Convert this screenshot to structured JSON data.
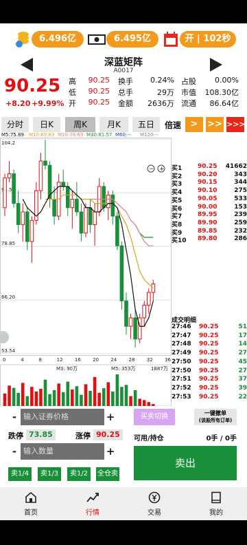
{
  "stats_bar": {
    "total_amount_1": "6.496亿",
    "total_amount_2": "6.495亿",
    "market_status": "开 | 102秒"
  },
  "stock": {
    "name": "深蓝矩阵",
    "code": "A0017",
    "price": "90.25",
    "change": "+8.20",
    "change_pct": "+9.99%"
  },
  "quote": {
    "high_label": "高",
    "high": "90.25",
    "low_label": "低",
    "low": "90.25",
    "open_label": "开",
    "open": "90.25",
    "turnover_label": "换手",
    "turnover": "0.24%",
    "total_shares_label": "总手",
    "total_shares": "29万",
    "amount_label": "金额",
    "amount": "2636万",
    "share_label": "占股",
    "share": "0.00%",
    "mktcap_label": "市值",
    "mktcap": "108.30亿",
    "float_label": "流通",
    "float": "86.64亿"
  },
  "tabs": [
    {
      "label": "分时"
    },
    {
      "label": "日K"
    },
    {
      "label": "周K"
    },
    {
      "label": "月K"
    },
    {
      "label": "五日"
    }
  ],
  "speed_label": "倍速",
  "speed_buttons": [
    ">",
    ">>",
    ">>>"
  ],
  "ma_legend": [
    {
      "label": "M5:75.89",
      "color": "#111111"
    },
    {
      "label": "M10:69.83",
      "color": "#e0a020"
    },
    {
      "label": "M20:78.69",
      "color": "#e08080"
    },
    {
      "label": "M30:81.57",
      "color": "#1a8f3a"
    },
    {
      "label": "M60:--",
      "color": "#2040d0"
    },
    {
      "label": "M120:--",
      "color": "#888888"
    }
  ],
  "y_ticks": [
    "104.2",
    "91.50",
    "78.85",
    "66.20",
    "53.54"
  ],
  "x_ticks": [
    "0",
    "4",
    "8",
    "12",
    "16",
    "20",
    "24",
    "28",
    "32",
    "36"
  ],
  "volume_legend": {
    "m3": "M3: 90万",
    "m5": "M5: 353万",
    "max": "1887万"
  },
  "order_book": [
    {
      "label": "买1",
      "price": "90.25",
      "vol": "41662"
    },
    {
      "label": "买2",
      "price": "90.20",
      "vol": "343"
    },
    {
      "label": "买3",
      "price": "90.15",
      "vol": "344"
    },
    {
      "label": "买4",
      "price": "90.10",
      "vol": "275"
    },
    {
      "label": "买5",
      "price": "90.05",
      "vol": "533"
    },
    {
      "label": "买6",
      "price": "90.00",
      "vol": "153"
    },
    {
      "label": "买7",
      "price": "89.95",
      "vol": "239"
    },
    {
      "label": "买8",
      "price": "89.90",
      "vol": "259"
    },
    {
      "label": "买9",
      "price": "89.85",
      "vol": "232"
    },
    {
      "label": "买10",
      "price": "89.80",
      "vol": "286"
    }
  ],
  "trades_title": "成交明细",
  "trades": [
    {
      "time": "27:46",
      "price": "90.25",
      "vol": "51"
    },
    {
      "time": "27:47",
      "price": "90.25",
      "vol": "17"
    },
    {
      "time": "27:48",
      "price": "90.25",
      "vol": "14"
    },
    {
      "time": "27:49",
      "price": "90.25",
      "vol": "27"
    },
    {
      "time": "27:50",
      "price": "90.25",
      "vol": "45"
    },
    {
      "time": "27:50",
      "price": "90.25",
      "vol": "27"
    },
    {
      "time": "27:51",
      "price": "90.25",
      "vol": "37"
    },
    {
      "time": "27:52",
      "price": "90.25",
      "vol": "39"
    },
    {
      "time": "27:53",
      "price": "90.25",
      "vol": "22"
    }
  ],
  "form": {
    "price_placeholder": "输入证券价格",
    "qty_placeholder": "输入数量",
    "limit_down_label": "跌停",
    "limit_down": "73.85",
    "limit_up_label": "涨停",
    "limit_up": "90.25",
    "switch_label": "买卖切换",
    "cancel_all_line1": "一键撤单",
    "cancel_all_line2": "(该股所有订单)",
    "avail_label": "可用/持仓",
    "avail_value": "0手 / 0手",
    "sell_label": "卖出",
    "quick": [
      "卖1/4",
      "卖1/3",
      "卖1/2",
      "全仓卖"
    ]
  },
  "nav": [
    {
      "label": "首页",
      "icon": "home-icon",
      "active": false
    },
    {
      "label": "行情",
      "icon": "chart-line-icon",
      "active": true
    },
    {
      "label": "交易",
      "icon": "yuan-exchange-icon",
      "active": false
    },
    {
      "label": "我的",
      "icon": "book-icon",
      "active": false
    }
  ],
  "chart_data": {
    "type": "candlestick",
    "x": [
      0,
      1,
      2,
      3,
      4,
      5,
      6,
      7,
      8,
      9,
      10,
      11,
      12,
      13,
      14,
      15,
      16,
      17,
      18,
      19,
      20,
      21,
      22,
      23,
      24,
      25,
      26,
      27,
      28,
      29,
      30,
      31,
      32,
      33
    ],
    "ohlc": [
      [
        88,
        96,
        86,
        95
      ],
      [
        95,
        99,
        94,
        96
      ],
      [
        96,
        97,
        88,
        89
      ],
      [
        89,
        92,
        82,
        84
      ],
      [
        84,
        89,
        80,
        87
      ],
      [
        87,
        88,
        78,
        80
      ],
      [
        80,
        86,
        75,
        85
      ],
      [
        85,
        94,
        84,
        92
      ],
      [
        92,
        101,
        90,
        99
      ],
      [
        99,
        104,
        97,
        98
      ],
      [
        98,
        99,
        88,
        90
      ],
      [
        90,
        93,
        84,
        86
      ],
      [
        86,
        96,
        85,
        94
      ],
      [
        94,
        97,
        92,
        93
      ],
      [
        93,
        94,
        86,
        88
      ],
      [
        88,
        92,
        83,
        90
      ],
      [
        90,
        94,
        86,
        87
      ],
      [
        87,
        89,
        80,
        82
      ],
      [
        82,
        89,
        81,
        88
      ],
      [
        88,
        90,
        82,
        84
      ],
      [
        84,
        89,
        79,
        87
      ],
      [
        87,
        95,
        86,
        93
      ],
      [
        93,
        94,
        87,
        88
      ],
      [
        88,
        92,
        85,
        91
      ],
      [
        91,
        92,
        84,
        86
      ],
      [
        86,
        87,
        78,
        79
      ],
      [
        79,
        80,
        64,
        66
      ],
      [
        66,
        68,
        58,
        60
      ],
      [
        60,
        63,
        57,
        62
      ],
      [
        62,
        64,
        55,
        57
      ],
      [
        57,
        63,
        56,
        62
      ],
      [
        62,
        66,
        60,
        65
      ],
      [
        65,
        69,
        63,
        68
      ],
      [
        68,
        71,
        66,
        70
      ]
    ],
    "ma5": [
      null,
      null,
      null,
      null,
      90,
      88,
      87,
      86,
      87,
      89,
      91,
      92,
      93,
      93,
      93,
      92,
      91,
      90,
      88,
      88,
      87,
      87,
      88,
      89,
      89,
      88,
      84,
      78,
      72,
      64,
      60,
      60,
      62,
      66
    ],
    "ma10": [
      null,
      null,
      null,
      null,
      null,
      null,
      null,
      null,
      null,
      90,
      90,
      90,
      90,
      91,
      91,
      91,
      91,
      90,
      90,
      90,
      89,
      89,
      89,
      89,
      89,
      88,
      86,
      84,
      81,
      77,
      73,
      71,
      70,
      69
    ],
    "ma20": [
      null,
      null,
      null,
      null,
      null,
      null,
      null,
      null,
      null,
      null,
      null,
      null,
      null,
      null,
      null,
      null,
      null,
      null,
      null,
      90,
      90,
      90,
      90,
      90,
      90,
      89,
      88,
      87,
      85,
      84,
      82,
      80,
      79,
      79
    ],
    "ma30": [
      null,
      null,
      null,
      null,
      null,
      null,
      null,
      null,
      null,
      null,
      null,
      null,
      null,
      null,
      null,
      null,
      null,
      null,
      null,
      null,
      null,
      null,
      null,
      null,
      null,
      null,
      null,
      null,
      null,
      84,
      82,
      81,
      81,
      81
    ],
    "volume": [
      38,
      62,
      55,
      40,
      70,
      30,
      58,
      44,
      52,
      80,
      36,
      48,
      68,
      42,
      74,
      50,
      60,
      34,
      66,
      46,
      88,
      40,
      54,
      72,
      44,
      96,
      58,
      64,
      30,
      48,
      22,
      18,
      12,
      6
    ],
    "ylim": [
      53.54,
      104.2
    ],
    "xlim": [
      0,
      36
    ]
  }
}
